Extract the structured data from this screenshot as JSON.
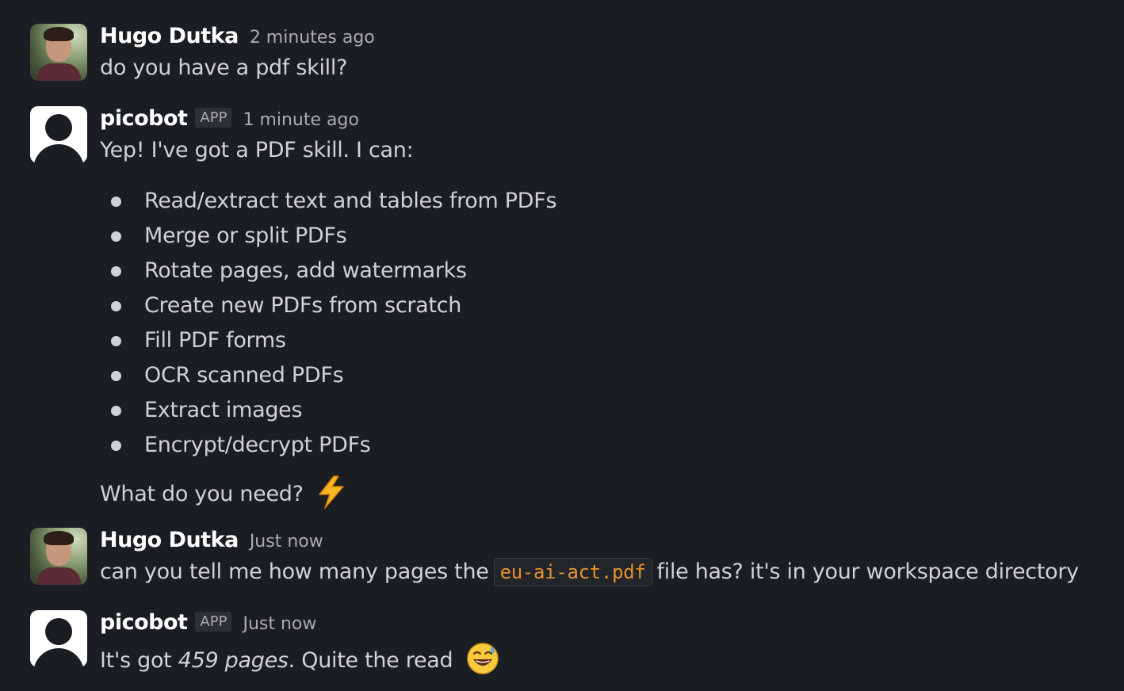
{
  "messages": [
    {
      "author": "Hugo Dutka",
      "time": "2 minutes ago",
      "text": "do you have a pdf skill?"
    },
    {
      "author": "picobot",
      "badge": "APP",
      "time": "1 minute ago",
      "intro": "Yep! I've got a PDF skill. I can:",
      "bullets": [
        "Read/extract text and tables from PDFs",
        "Merge or split PDFs",
        "Rotate pages, add watermarks",
        "Create new PDFs from scratch",
        "Fill PDF forms",
        "OCR scanned PDFs",
        "Extract images",
        "Encrypt/decrypt PDFs"
      ],
      "outro": "What do you need?",
      "outro_emoji": "high-voltage-emoji"
    },
    {
      "author": "Hugo Dutka",
      "time": "Just now",
      "text_before": "can you tell me how many pages the",
      "code": "eu-ai-act.pdf",
      "text_after": "file has? it's in your workspace directory"
    },
    {
      "author": "picobot",
      "badge": "APP",
      "time": "Just now",
      "text_before": "It's got ",
      "emphasis": "459 pages",
      "text_after": ". Quite the read",
      "emoji": "grinning-face-with-sweat-emoji"
    }
  ],
  "colors": {
    "background": "#1a1d21",
    "text": "#d1d2d3",
    "muted": "#ababad",
    "name": "#ffffff",
    "code": "#e8912d"
  }
}
